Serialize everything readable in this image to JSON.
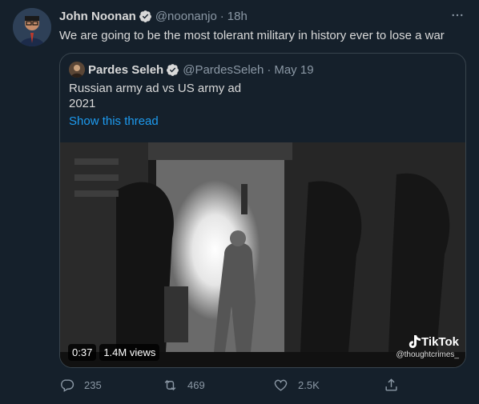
{
  "tweet": {
    "display_name": "John Noonan",
    "handle": "@noonanjo",
    "time": "18h",
    "text": "We are going to be the most tolerant military in history ever to lose a war",
    "dot": "·"
  },
  "quote": {
    "display_name": "Pardes Seleh",
    "handle": "@PardesSeleh",
    "date": "May 19",
    "dot": "·",
    "text_line1": "Russian army ad vs US army ad",
    "text_line2": "2021",
    "show_thread": "Show this thread",
    "media": {
      "duration": "0:37",
      "views": "1.4M views",
      "watermark_brand": "TikTok",
      "watermark_user": "@thoughtcrimes_"
    }
  },
  "actions": {
    "replies": "235",
    "retweets": "469",
    "likes": "2.5K"
  },
  "colors": {
    "background": "#15202b",
    "accent": "#1d9bf0",
    "secondary_text": "#8b98a5",
    "border": "#38444d"
  }
}
